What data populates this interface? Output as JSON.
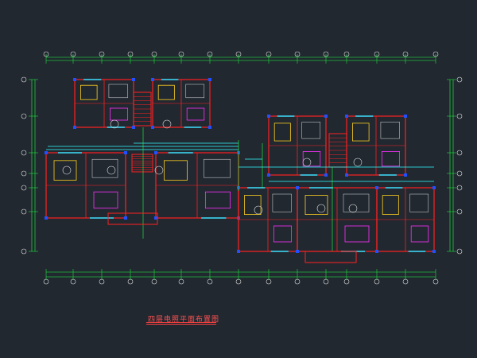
{
  "drawing": {
    "title": "四层电照平面布置图",
    "background": "#212830",
    "colors": {
      "wall": "#ff2020",
      "window": "#30e0ff",
      "furniture": "#ffd020",
      "column": "#2050ff",
      "dimension": "#20ff40",
      "grid_bubble": "#e0e0e0",
      "wiring": "#30ffff",
      "magenta": "#ff30ff"
    }
  }
}
